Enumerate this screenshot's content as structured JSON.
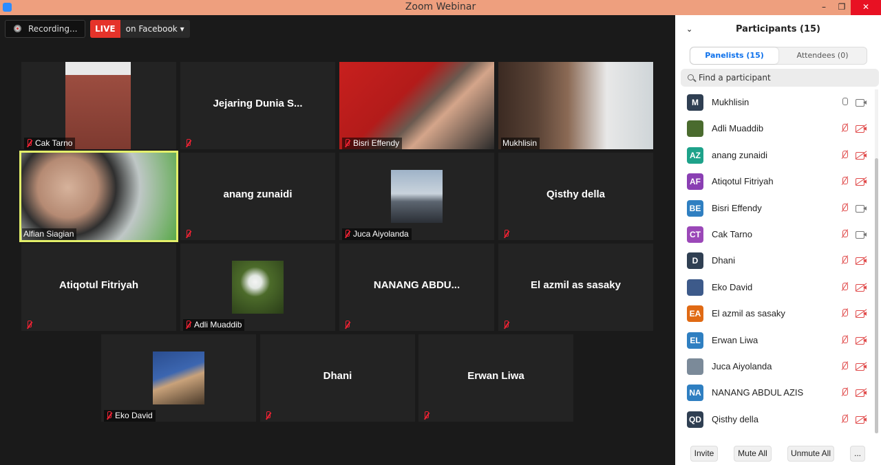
{
  "window": {
    "title": "Zoom Webinar",
    "minimize": "–",
    "maximize": "❐",
    "close": "✕"
  },
  "toolbar": {
    "recording": "Recording...",
    "live_badge": "LIVE",
    "live_target": "on Facebook ▾"
  },
  "tiles": [
    {
      "name": "Cak Tarno",
      "label": "Cak Tarno",
      "video": true
    },
    {
      "name": "Jejaring  Dunia  S...",
      "label": "",
      "video": false
    },
    {
      "name": "Bisri Effendy",
      "label": "Bisri Effendy",
      "video": true
    },
    {
      "name": "Mukhlisin",
      "label": "Mukhlisin",
      "video": true
    },
    {
      "name": "Alfian Siagian",
      "label": "Alfian Siagian",
      "video": true
    },
    {
      "name": "anang zunaidi",
      "label": "",
      "video": false
    },
    {
      "name": "Juca Aiyolanda",
      "label": "Juca Aiyolanda",
      "video": true
    },
    {
      "name": "Qisthy della",
      "label": "",
      "video": false
    },
    {
      "name": "Atiqotul Fitriyah",
      "label": "",
      "video": false
    },
    {
      "name": "Adli Muaddib",
      "label": "Adli Muaddib",
      "video": true
    },
    {
      "name": "NANANG  ABDU...",
      "label": "",
      "video": false
    },
    {
      "name": "El azmil as sasaky",
      "label": "",
      "video": false
    },
    {
      "name": "Eko David",
      "label": "Eko David",
      "video": true
    },
    {
      "name": "Dhani",
      "label": "",
      "video": false
    },
    {
      "name": "Erwan Liwa",
      "label": "",
      "video": false
    }
  ],
  "panel": {
    "title": "Participants (15)",
    "tabs": {
      "panelists": "Panelists (15)",
      "attendees": "Attendees (0)"
    },
    "search_placeholder": "Find a participant",
    "participants": [
      {
        "initials": "M",
        "name": "Mukhlisin",
        "color": "#2f3f52",
        "mic": "on",
        "cam": "on"
      },
      {
        "initials": "",
        "name": "Adli Muaddib",
        "color": "#4a6b2e",
        "mic": "off",
        "cam": "off"
      },
      {
        "initials": "AZ",
        "name": "anang zunaidi",
        "color": "#1ea28a",
        "mic": "off",
        "cam": "off"
      },
      {
        "initials": "AF",
        "name": "Atiqotul Fitriyah",
        "color": "#8a3fb3",
        "mic": "off",
        "cam": "off"
      },
      {
        "initials": "BE",
        "name": "Bisri Effendy",
        "color": "#2f7fc1",
        "mic": "off",
        "cam": "on"
      },
      {
        "initials": "CT",
        "name": "Cak Tarno",
        "color": "#9b48b8",
        "mic": "off",
        "cam": "on"
      },
      {
        "initials": "D",
        "name": "Dhani",
        "color": "#2f3f52",
        "mic": "off",
        "cam": "off"
      },
      {
        "initials": "",
        "name": "Eko David",
        "color": "#3d5a8a",
        "mic": "off",
        "cam": "off"
      },
      {
        "initials": "EA",
        "name": "El azmil as sasaky",
        "color": "#e06a14",
        "mic": "off",
        "cam": "off"
      },
      {
        "initials": "EL",
        "name": "Erwan Liwa",
        "color": "#2f7fc1",
        "mic": "off",
        "cam": "off"
      },
      {
        "initials": "",
        "name": "Juca Aiyolanda",
        "color": "#7b8a99",
        "mic": "off",
        "cam": "off"
      },
      {
        "initials": "NA",
        "name": "NANANG ABDUL AZIS",
        "color": "#2f7fc1",
        "mic": "off",
        "cam": "off"
      },
      {
        "initials": "QD",
        "name": "Qisthy della",
        "color": "#2f3f52",
        "mic": "off",
        "cam": "off"
      }
    ],
    "buttons": {
      "invite": "Invite",
      "mute_all": "Mute All",
      "unmute_all": "Unmute All",
      "more": "..."
    }
  }
}
